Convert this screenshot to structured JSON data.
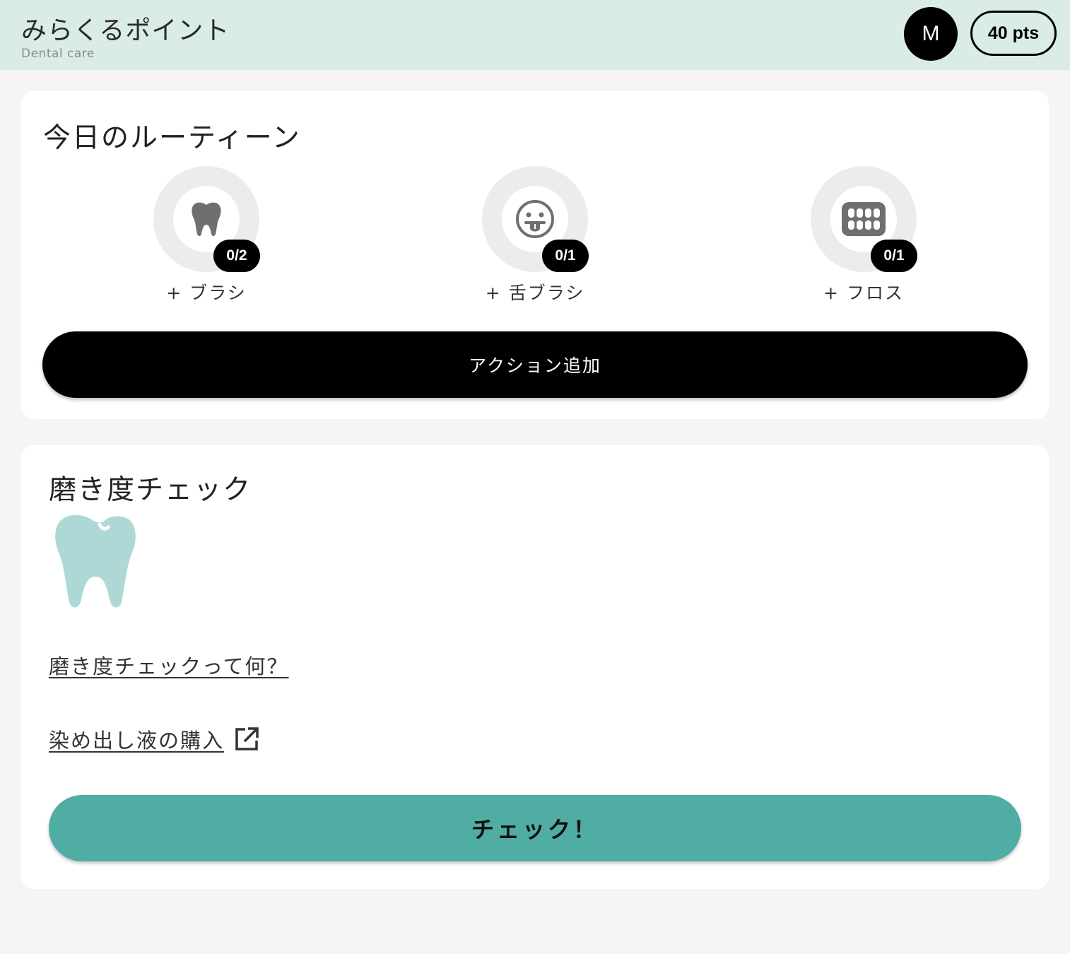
{
  "header": {
    "title": "みらくるポイント",
    "subtitle": "Dental care",
    "avatar_initial": "M",
    "points": "40 pts"
  },
  "routine": {
    "title": "今日のルーティーン",
    "items": [
      {
        "icon": "tooth-icon",
        "count": "0/2",
        "label": "+ ブラシ"
      },
      {
        "icon": "tongue-face-icon",
        "count": "0/1",
        "label": "+ 舌ブラシ"
      },
      {
        "icon": "teeth-grid-icon",
        "count": "0/1",
        "label": "+ フロス"
      }
    ],
    "add_action_label": "アクション追加"
  },
  "check": {
    "title": "磨き度チェック",
    "what_link": "磨き度チェックって何？",
    "buy_link": "染め出し液の購入",
    "check_button": "チェック！"
  },
  "colors": {
    "header_bg": "#d9ece5",
    "accent_teal": "#4fada3",
    "tooth_light": "#aed8d5"
  }
}
